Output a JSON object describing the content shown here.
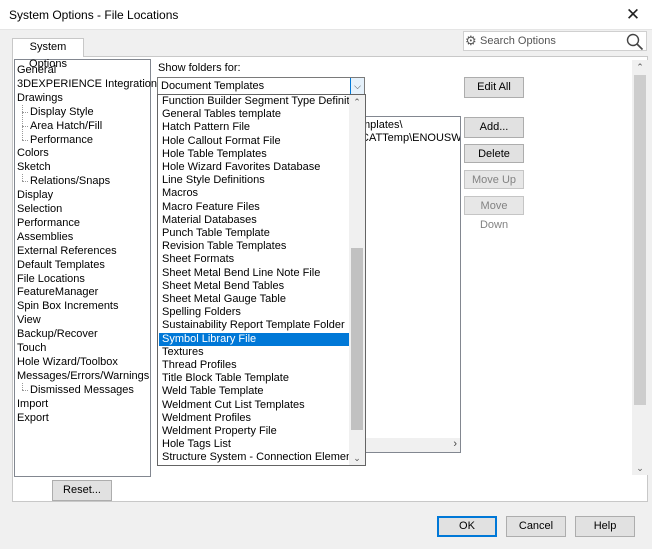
{
  "window": {
    "title": "System Options - File Locations",
    "close_label": "✕"
  },
  "tab": {
    "label": "System Options"
  },
  "search": {
    "placeholder": "Search Options",
    "gear_icon": "gear-icon",
    "search_icon": "magnifier-icon"
  },
  "tree": {
    "items": [
      {
        "label": "General"
      },
      {
        "label": "3DEXPERIENCE Integration"
      },
      {
        "label": "Drawings"
      },
      {
        "label": "Display Style",
        "child": true
      },
      {
        "label": "Area Hatch/Fill",
        "child": true
      },
      {
        "label": "Performance",
        "child": true
      },
      {
        "label": "Colors"
      },
      {
        "label": "Sketch"
      },
      {
        "label": "Relations/Snaps",
        "child": true
      },
      {
        "label": "Display"
      },
      {
        "label": "Selection"
      },
      {
        "label": "Performance"
      },
      {
        "label": "Assemblies"
      },
      {
        "label": "External References"
      },
      {
        "label": "Default Templates"
      },
      {
        "label": "File Locations"
      },
      {
        "label": "FeatureManager"
      },
      {
        "label": "Spin Box Increments"
      },
      {
        "label": "View"
      },
      {
        "label": "Backup/Recover"
      },
      {
        "label": "Touch"
      },
      {
        "label": "Hole Wizard/Toolbox"
      },
      {
        "label": "Messages/Errors/Warnings"
      },
      {
        "label": "Dismissed Messages",
        "child": true
      },
      {
        "label": "Import"
      },
      {
        "label": "Export"
      }
    ]
  },
  "show_folders": {
    "label": "Show folders for:",
    "selected": "Document Templates"
  },
  "folder_paths": [
    "mplates\\",
    "CATTemp\\ENOUSWC\\Re"
  ],
  "dropdown": {
    "items": [
      "Function Builder Segment Type Definitions",
      "General Tables template",
      "Hatch Pattern File",
      "Hole Callout Format File",
      "Hole Table Templates",
      "Hole Wizard Favorites Database",
      "Line Style Definitions",
      "Macros",
      "Macro Feature Files",
      "Material Databases",
      "Punch Table Template",
      "Revision Table Templates",
      "Sheet Formats",
      "Sheet Metal Bend Line Note File",
      "Sheet Metal Bend Tables",
      "Sheet Metal Gauge Table",
      "Spelling Folders",
      "Sustainability Report Template Folder",
      "Symbol Library File",
      "Textures",
      "Thread Profiles",
      "Title Block Table Template",
      "Weld Table Template",
      "Weldment Cut List Templates",
      "Weldment Profiles",
      "Weldment Property File",
      "Hole Tags List",
      "Structure System - Connection Elements"
    ],
    "selected_index": 18
  },
  "buttons": {
    "edit_all": "Edit All",
    "add": "Add...",
    "delete": "Delete",
    "move_up": "Move Up",
    "move_down": "Move Down",
    "reset": "Reset...",
    "ok": "OK",
    "cancel": "Cancel",
    "help": "Help"
  },
  "colors": {
    "selection": "#0078d7",
    "accent": "#0078d7"
  }
}
